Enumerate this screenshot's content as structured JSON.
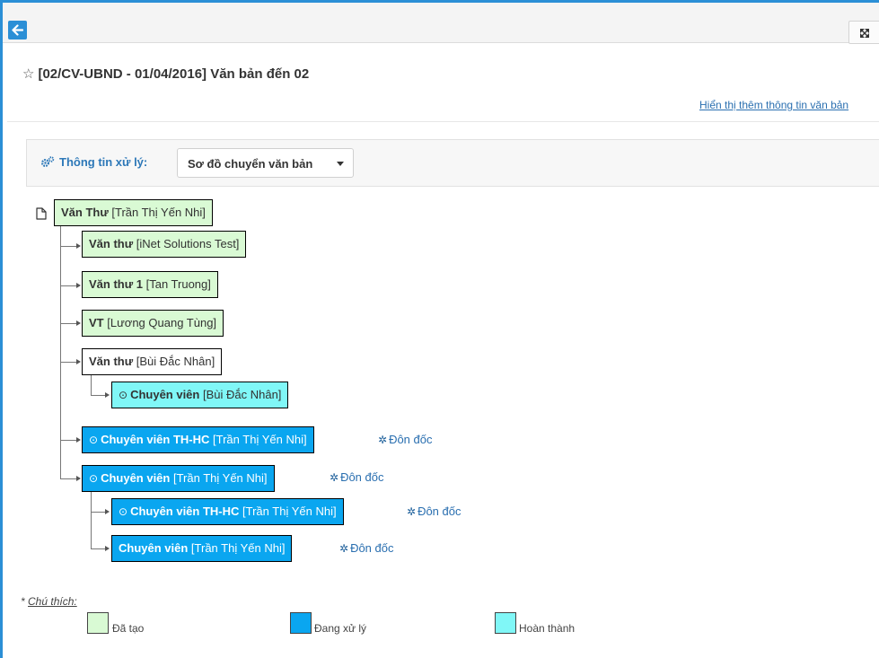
{
  "document": {
    "title": "[02/CV-UBND - 01/04/2016] Văn bản đến 02",
    "more_info_link": "Hiển thị thêm thông tin văn bản"
  },
  "processing": {
    "label": "Thông tin xử lý:",
    "view_selected": "Sơ đồ chuyển văn bản"
  },
  "tree": {
    "root": {
      "role": "Văn Thư",
      "person": "[Trần Thị Yến Nhi]",
      "status": "created"
    },
    "nodes": [
      {
        "role": "Văn thư",
        "person": "[iNet Solutions Test]",
        "status": "created",
        "checked": false
      },
      {
        "role": "Văn thư 1",
        "person": "[Tan Truong]",
        "status": "created",
        "checked": false
      },
      {
        "role": "VT",
        "person": "[Lương Quang Tùng]",
        "status": "created",
        "checked": false
      },
      {
        "role": "Văn thư",
        "person": "[Bùi Đắc Nhân]",
        "status": "none",
        "checked": false
      },
      {
        "role": "Chuyên viên",
        "person": "[Bùi Đắc Nhân]",
        "status": "completed",
        "checked": true
      },
      {
        "role": "Chuyên viên TH-HC",
        "person": "[Trần Thị Yến Nhi]",
        "status": "processing",
        "checked": true,
        "urge": "Đôn đốc"
      },
      {
        "role": "Chuyên viên",
        "person": "[Trần Thị Yến Nhi]",
        "status": "processing",
        "checked": true,
        "urge": "Đôn đốc"
      },
      {
        "role": "Chuyên viên TH-HC",
        "person": "[Trần Thị Yến Nhi]",
        "status": "processing",
        "checked": true,
        "urge": "Đôn đốc"
      },
      {
        "role": "Chuyên viên",
        "person": "[Trần Thị Yến Nhi]",
        "status": "processing",
        "checked": false,
        "urge": "Đôn đốc"
      }
    ]
  },
  "legend": {
    "title_prefix": "* ",
    "title": "Chú thích:",
    "items": [
      {
        "label": "Đã tạo",
        "color": "#d9fad4"
      },
      {
        "label": "Đang xử lý",
        "color": "#0aa6f0"
      },
      {
        "label": "Hoàn thành",
        "color": "#80f7f7"
      }
    ]
  },
  "icons": {
    "back": "arrow-left-icon",
    "expand": "expand-icon",
    "star": "star-outline-icon",
    "settings": "gears-icon",
    "document": "file-icon",
    "check": "check-circle-icon",
    "urge": "gear-icon"
  },
  "colors": {
    "accent": "#2b8fd6",
    "created": "#d9fad4",
    "processing": "#0aa6f0",
    "completed": "#80f7f7",
    "link": "#2a6fb0"
  }
}
